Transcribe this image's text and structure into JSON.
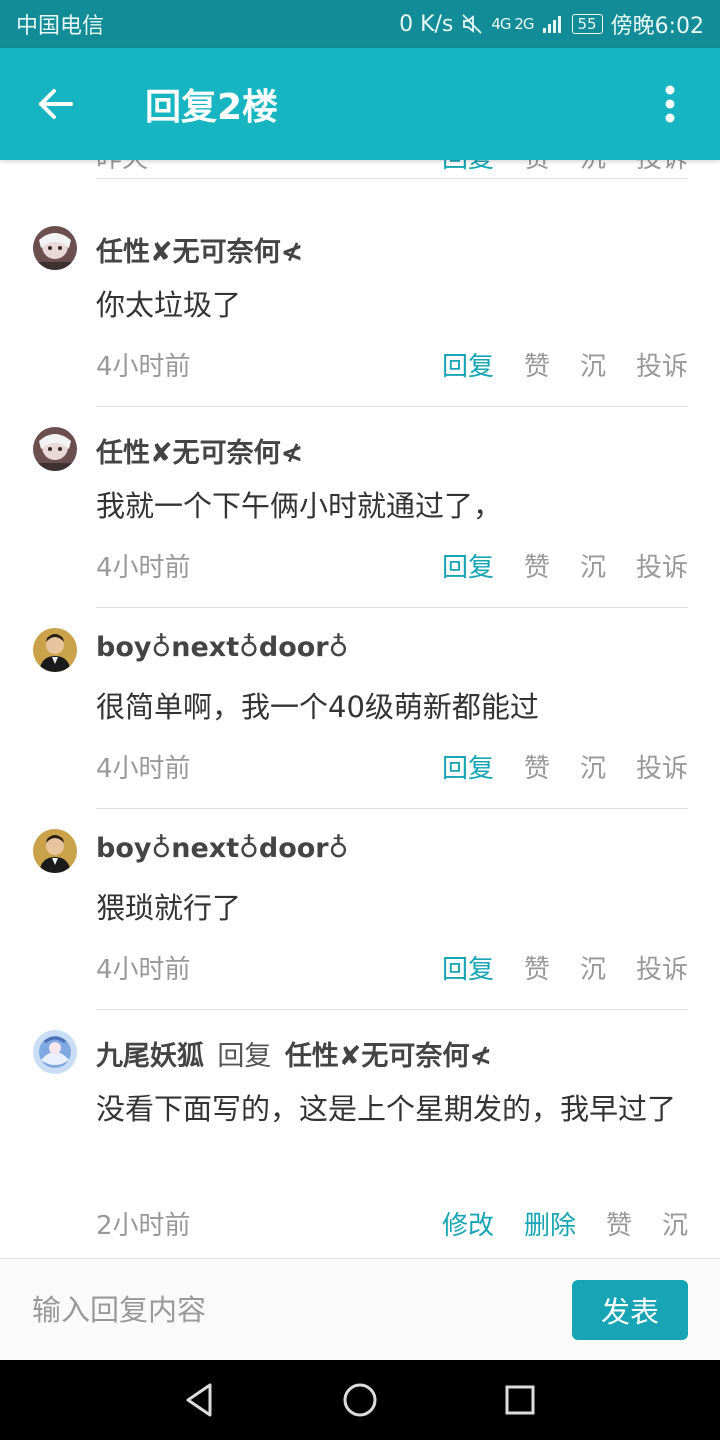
{
  "status_bar": {
    "carrier": "中国电信",
    "speed": "0 K/s",
    "network": "4G 2G",
    "battery": "55",
    "time": "傍晚6:02"
  },
  "app_bar": {
    "title": "回复2楼"
  },
  "partial_row": {
    "time": "昨天",
    "actions": [
      "回复",
      "赞",
      "沉",
      "投诉"
    ]
  },
  "comments": [
    {
      "user": "任性✘无可奈何≮",
      "text": "你太垃圾了",
      "time": "4小时前",
      "actions": [
        "回复",
        "赞",
        "沉",
        "投诉"
      ]
    },
    {
      "user": "任性✘无可奈何≮",
      "text": "我就一个下午俩小时就通过了，",
      "time": "4小时前",
      "actions": [
        "回复",
        "赞",
        "沉",
        "投诉"
      ]
    },
    {
      "user": "boy♁next♁door♁",
      "text": "很简单啊，我一个40级萌新都能过",
      "time": "4小时前",
      "actions": [
        "回复",
        "赞",
        "沉",
        "投诉"
      ]
    },
    {
      "user": "boy♁next♁door♁",
      "text": "猥琐就行了",
      "time": "4小时前",
      "actions": [
        "回复",
        "赞",
        "沉",
        "投诉"
      ]
    },
    {
      "user": "九尾妖狐",
      "reply_word": "回复",
      "reply_to": "任性✘无可奈何≮",
      "text": "没看下面写的，这是上个星期发的，我早过了",
      "time": "2小时前",
      "actions": [
        "修改",
        "删除",
        "赞",
        "沉"
      ]
    }
  ],
  "input_bar": {
    "placeholder": "输入回复内容",
    "send_label": "发表"
  },
  "icons": {
    "back": "arrow-left-icon",
    "more": "more-vertical-icon",
    "nav_back": "triangle-back-icon",
    "nav_home": "circle-home-icon",
    "nav_recent": "square-recent-icon"
  },
  "colors": {
    "status_bar": "#128c96",
    "app_bar": "#17b5c1",
    "accent": "#17a5b5"
  }
}
